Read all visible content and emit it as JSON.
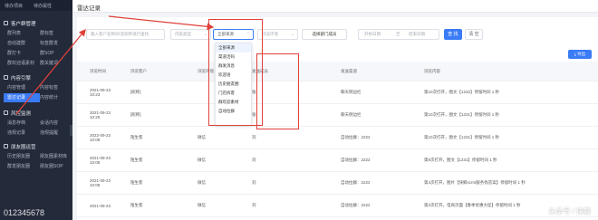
{
  "sidebar": {
    "top": [
      "待办项目",
      "待办属性"
    ],
    "sections": [
      {
        "title": "客户群管理",
        "rows": [
          [
            "群列表",
            "群标签"
          ],
          [
            "自动建群",
            "标签群发"
          ],
          [
            "群打卡",
            "群SOP"
          ],
          [
            "群欢迎语素材",
            "群关键词"
          ]
        ]
      },
      {
        "title": "内容引擎",
        "rows": [
          [
            "内容管理",
            "内容标签"
          ],
          [
            "雷达记录",
            "内容统计"
          ]
        ]
      },
      {
        "title": "风控监测",
        "rows": [
          [
            "消息存档",
            "会话内容"
          ],
          [
            "违规记录",
            "违规提醒"
          ]
        ]
      },
      {
        "title": "朋友圈运营",
        "rows": [
          [
            "历史朋友圈",
            "朋友圈素材库"
          ],
          [
            "群发朋友圈",
            "朋友圈SOP"
          ]
        ]
      }
    ],
    "active": "雷达记录",
    "watermark": "012345678"
  },
  "topbar": {
    "tab": "雷达记录"
  },
  "filters": {
    "search_placeholder": "输入客户名称/好友昵称进行查找",
    "content_type": "内容类型",
    "channel_selected": "全部来源",
    "env": "浏览环境",
    "dept": "选择部门成员",
    "start_date": "开始日期",
    "to": "至",
    "end_date": "结束日期",
    "search_btn": "查 找",
    "clear_btn": "清 空"
  },
  "export_btn": "导出",
  "dropdown": [
    "全部来源",
    "渠道活码",
    "群发消息",
    "欢迎语",
    "历史朋友圈",
    "门店拆客",
    "群欢迎素材",
    "自动拉群"
  ],
  "table": {
    "headers": [
      "浏览时间",
      "浏览客户",
      "浏览环境",
      "发送成员",
      "发送渠道",
      "浏览内容"
    ],
    "rows": [
      {
        "date": "2021-09-23",
        "time": "10:23",
        "customer": "[昵称]",
        "env": "",
        "member": "张",
        "channel": "聊天侧边栏",
        "content": "第10次打开，图文【1232】停留时间 1 秒"
      },
      {
        "date": "2021-09-23",
        "time": "10:20",
        "customer": "[昵称]",
        "env": "",
        "member": "张",
        "channel": "聊天侧边栏",
        "content": "第10次打开，图文【1231】停留时间 1 秒"
      },
      {
        "date": "2022-09-23",
        "time": "10:08",
        "customer": "陌生客",
        "env": "微信",
        "member": "刘",
        "channel": "自动拉群：2222",
        "content": "第10次打开，图文【1231】停留时间 1 秒"
      },
      {
        "date": "2021-09-23",
        "time": "10:08",
        "customer": "陌生客",
        "env": "微信",
        "member": "刘",
        "channel": "自动拉群：2222",
        "content": "第9次打开，图文【1231】停留时间 1 秒"
      },
      {
        "date": "2021-09-23",
        "time": "10:08",
        "customer": "陌生客",
        "env": "微信",
        "member": "刘",
        "channel": "自动拉群：2222",
        "content": "第4次打开，图片【快鲸scrm服务找答案】停留时间 1 秒"
      },
      {
        "date": "2021-09-23",
        "time": "",
        "customer": "陌生客",
        "env": "微信",
        "member": "刘",
        "channel": "自动拉群：2222",
        "content": "第3次打开，电商页面【春季优惠大促】停留时间 1 秒"
      }
    ]
  },
  "watermark_right": "头条号 / 快鲸",
  "colors": {
    "accent": "#3a7bf6",
    "annotation": "#e0413a",
    "sidebar": "#232a3a"
  }
}
